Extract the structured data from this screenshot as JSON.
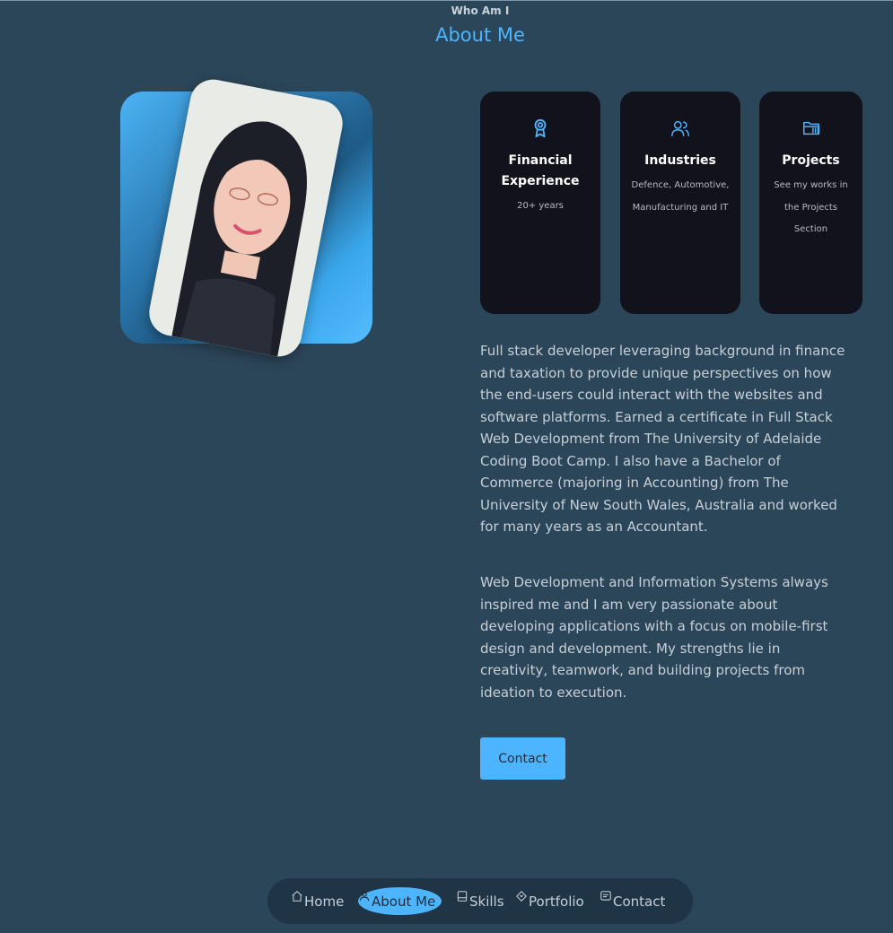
{
  "section": {
    "kicker": "Who Am I",
    "title": "About Me"
  },
  "cards": [
    {
      "icon": "award-icon",
      "title": "Financial Experience",
      "desc": "20+ years"
    },
    {
      "icon": "users-icon",
      "title": "Industries",
      "desc": "Defence, Automotive, Manufacturing and IT"
    },
    {
      "icon": "folder-icon",
      "title": "Projects",
      "desc": "See my works in the Projects Section"
    }
  ],
  "paragraphs": [
    "Full stack developer leveraging background in finance and taxation to provide unique perspectives on how the end-users could interact with the websites and software platforms. Earned a certificate in Full Stack Web Development from The University of Adelaide Coding Boot Camp. I also have a Bachelor of Commerce (majoring in Accounting) from The University of New South Wales, Australia and worked for many years as an Accountant.",
    "Web Development and Information Systems always inspired me and I am very passionate about developing applications with a focus on mobile-first design and development. My strengths lie in creativity, teamwork, and building projects from ideation to execution."
  ],
  "contact_button": "Contact",
  "nav": [
    {
      "icon": "home-icon",
      "label": "Home"
    },
    {
      "icon": "user-icon",
      "label": "About Me",
      "active": true
    },
    {
      "icon": "book-icon",
      "label": "Skills"
    },
    {
      "icon": "tag-icon",
      "label": "Portfolio"
    },
    {
      "icon": "message-icon",
      "label": "Contact"
    }
  ],
  "colors": {
    "background": "#2c4659",
    "accent": "#4db5ff",
    "card": "#12121c",
    "nav": "#1f3445"
  }
}
